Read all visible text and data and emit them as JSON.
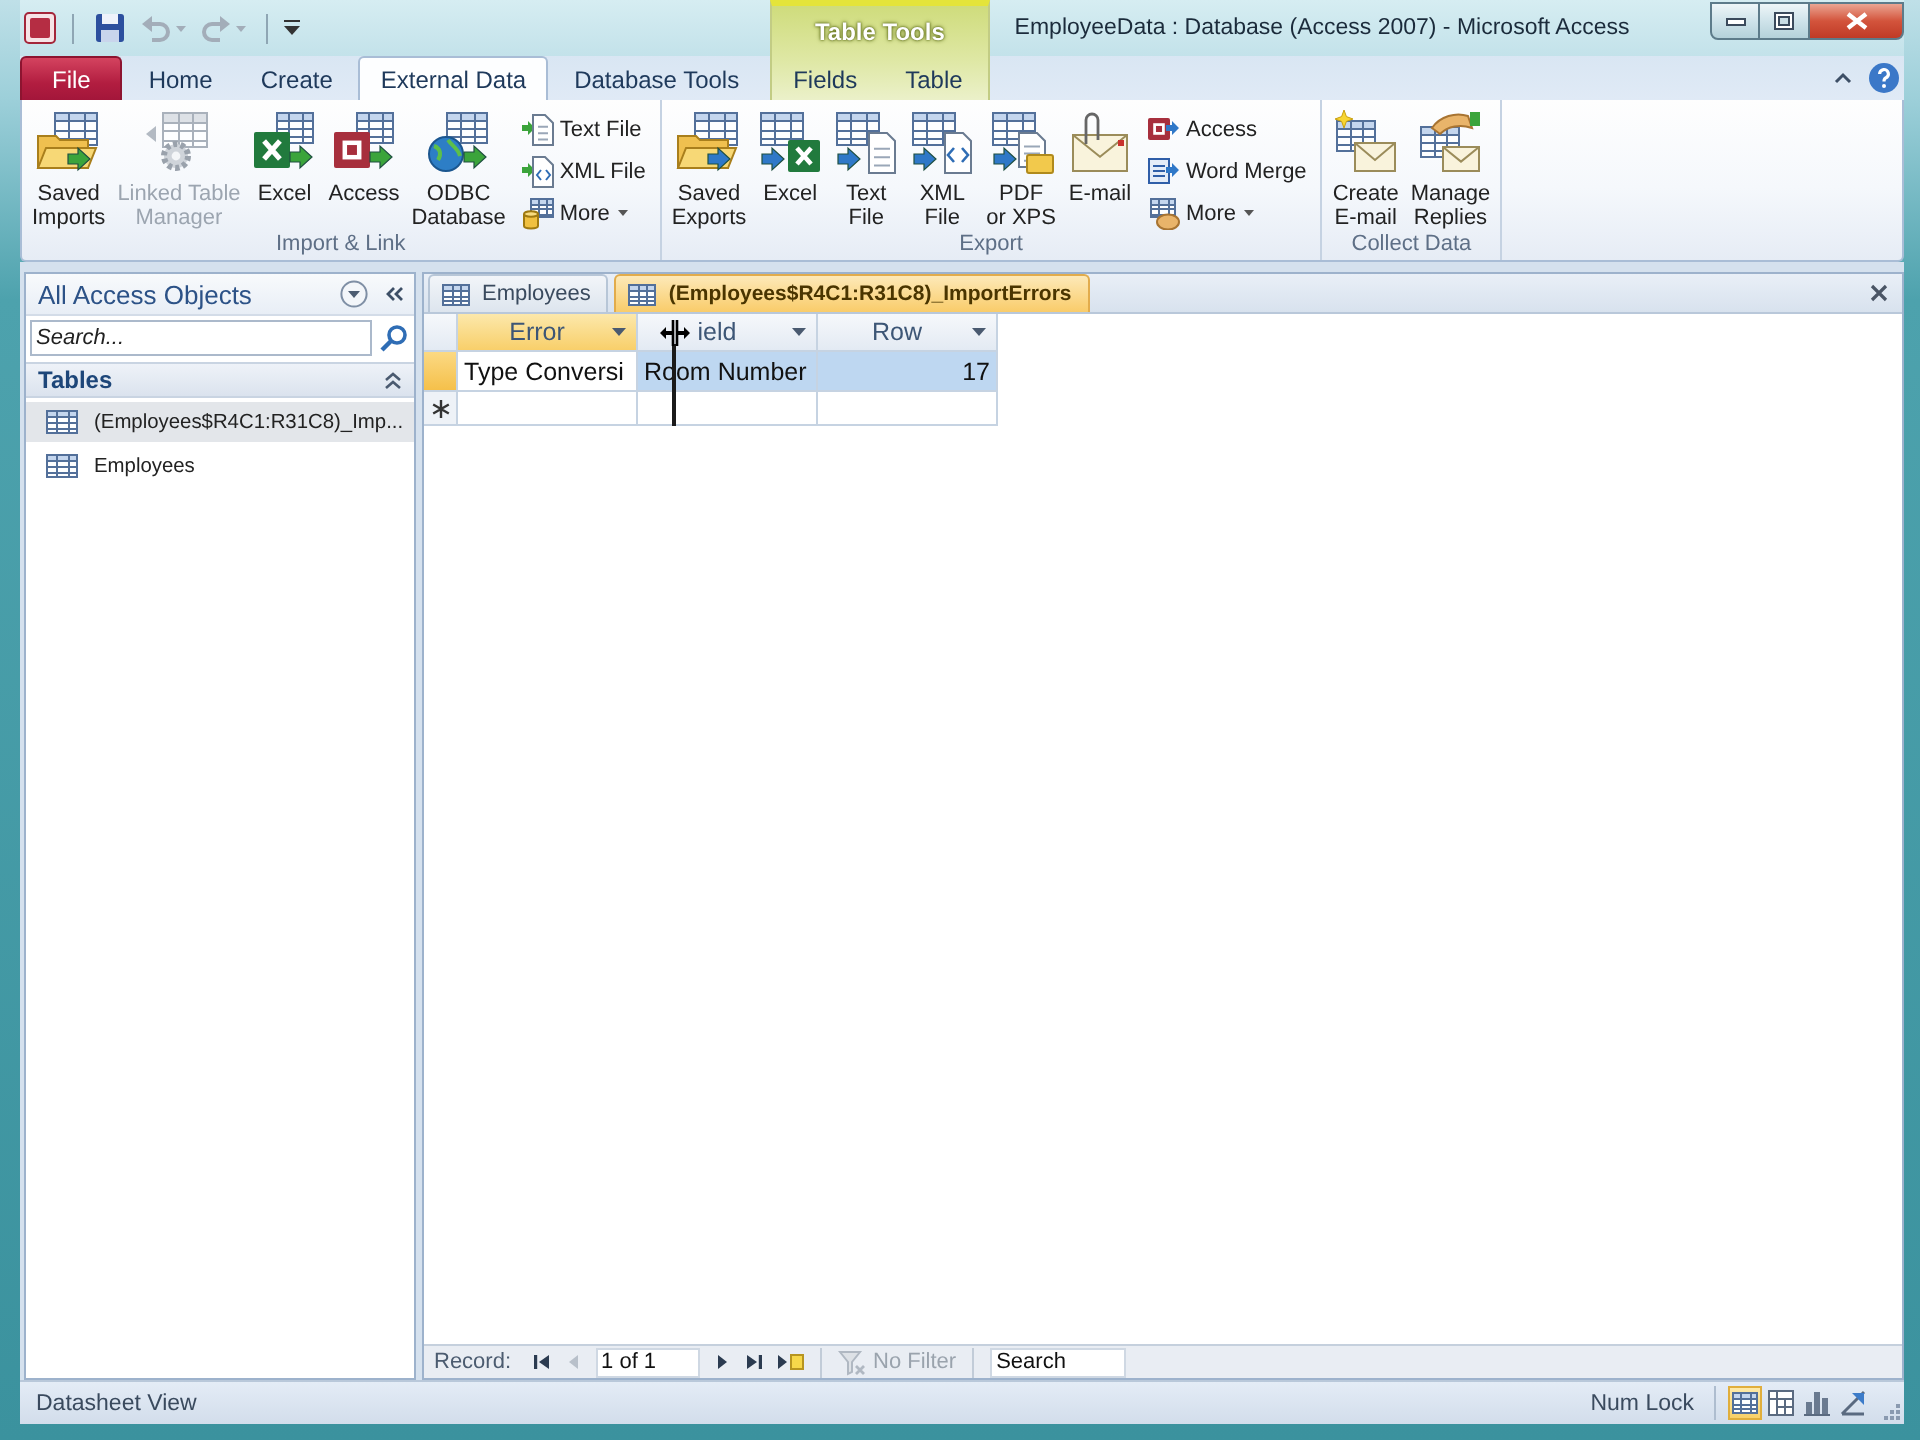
{
  "window": {
    "title": "EmployeeData : Database (Access 2007) - Microsoft Access"
  },
  "quick_access_toolbar": [
    {
      "kind": "save",
      "disabled": false
    },
    {
      "kind": "undo",
      "disabled": true
    },
    {
      "kind": "redo",
      "disabled": true
    }
  ],
  "contextual_group": {
    "title": "Table Tools"
  },
  "ribbon_tabs": [
    {
      "label": "File",
      "kind": "file",
      "selected": false
    },
    {
      "label": "Home",
      "kind": "normal",
      "selected": false
    },
    {
      "label": "Create",
      "kind": "normal",
      "selected": false
    },
    {
      "label": "External Data",
      "kind": "normal",
      "selected": true
    },
    {
      "label": "Database Tools",
      "kind": "normal",
      "selected": false
    },
    {
      "label": "Fields",
      "kind": "contextual",
      "selected": false
    },
    {
      "label": "Table",
      "kind": "contextual",
      "selected": false
    }
  ],
  "ribbon_groups": [
    {
      "label": "Import & Link",
      "buttons": [
        {
          "label": "Saved\nImports",
          "kind": "large",
          "disabled": false
        },
        {
          "label": "Linked Table\nManager",
          "kind": "large",
          "disabled": true
        },
        {
          "label": "Excel",
          "kind": "large",
          "disabled": false
        },
        {
          "label": "Access",
          "kind": "large",
          "disabled": false
        },
        {
          "label": "ODBC\nDatabase",
          "kind": "large",
          "disabled": false
        },
        {
          "label": "Text File",
          "kind": "small",
          "disabled": false
        },
        {
          "label": "XML File",
          "kind": "small",
          "disabled": false
        },
        {
          "label": "More",
          "kind": "small-menu",
          "disabled": false
        }
      ]
    },
    {
      "label": "Export",
      "buttons": [
        {
          "label": "Saved\nExports",
          "kind": "large",
          "disabled": false
        },
        {
          "label": "Excel",
          "kind": "large",
          "disabled": false
        },
        {
          "label": "Text\nFile",
          "kind": "large",
          "disabled": false
        },
        {
          "label": "XML\nFile",
          "kind": "large",
          "disabled": false
        },
        {
          "label": "PDF\nor XPS",
          "kind": "large",
          "disabled": false
        },
        {
          "label": "E-mail",
          "kind": "large",
          "disabled": false
        },
        {
          "label": "Access",
          "kind": "small",
          "disabled": false
        },
        {
          "label": "Word Merge",
          "kind": "small",
          "disabled": false
        },
        {
          "label": "More",
          "kind": "small-menu",
          "disabled": false
        }
      ]
    },
    {
      "label": "Collect Data",
      "buttons": [
        {
          "label": "Create\nE-mail",
          "kind": "large",
          "disabled": false
        },
        {
          "label": "Manage\nReplies",
          "kind": "large",
          "disabled": false
        }
      ]
    }
  ],
  "navigation_pane": {
    "title": "All Access Objects",
    "search": {
      "placeholder": "Search..."
    },
    "groups": [
      {
        "label": "Tables",
        "expanded": true,
        "items": [
          {
            "label": "(Employees$R4C1:R31C8)_Imp...",
            "selected": true
          },
          {
            "label": "Employees",
            "selected": false
          }
        ]
      }
    ]
  },
  "document_tabs": [
    {
      "label": "Employees",
      "selected": false
    },
    {
      "label": "(Employees$R4C1:R31C8)_ImportErrors",
      "selected": true
    }
  ],
  "datasheet": {
    "resize_cursor": true,
    "columns": [
      {
        "label": "Error",
        "kind": "text",
        "selected": true
      },
      {
        "label": "ield",
        "kind": "text",
        "selected": false
      },
      {
        "label": "Row",
        "kind": "number",
        "selected": false
      }
    ],
    "rows": [
      {
        "current": true,
        "cells": [
          {
            "text": "Type Conversi",
            "selected": false
          },
          {
            "text": "Room Number",
            "selected": true
          },
          {
            "text": "17",
            "selected": true
          }
        ]
      }
    ]
  },
  "record_navigation": {
    "label": "Record:",
    "controls": [
      {
        "kind": "first",
        "disabled": false
      },
      {
        "kind": "previous",
        "disabled": true
      },
      {
        "kind": "position",
        "value": "1 of 1"
      },
      {
        "kind": "next",
        "disabled": false
      },
      {
        "kind": "last",
        "disabled": false
      },
      {
        "kind": "new",
        "disabled": false
      }
    ],
    "filter": {
      "label": "No Filter",
      "disabled": true
    },
    "search": {
      "placeholder": "Search"
    }
  },
  "status_bar": {
    "view_name": "Datasheet View",
    "indicator": "Num Lock",
    "view_buttons": [
      {
        "selected": true
      },
      {
        "selected": false
      },
      {
        "selected": false
      },
      {
        "selected": false
      }
    ]
  }
}
